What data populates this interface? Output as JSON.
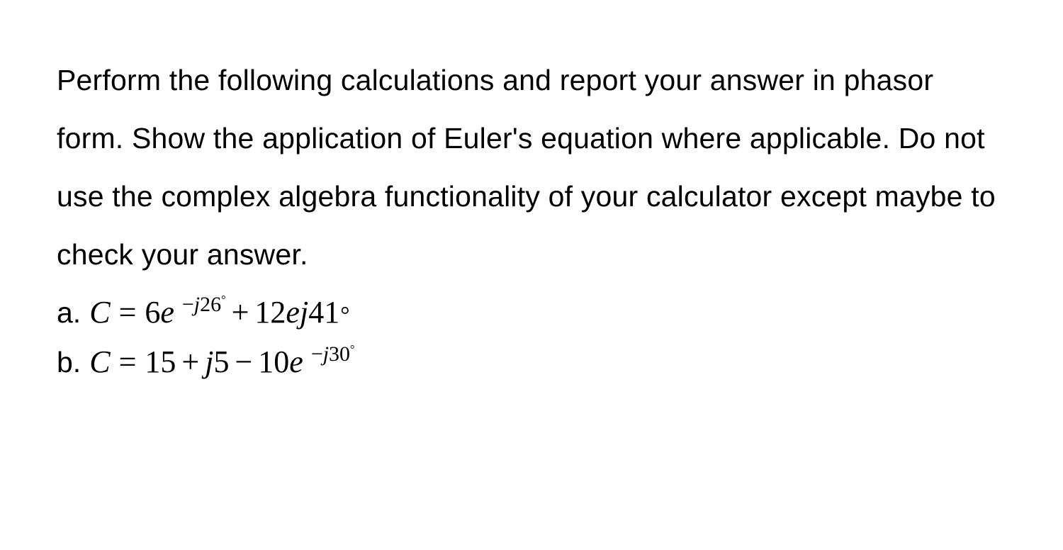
{
  "paragraph": "Perform the following calculations and report your answer in phasor form. Show the application of Euler's equation where applicable. Do not use the complex algebra functionality of your calculator except maybe to check your answer.",
  "items": {
    "a": {
      "label": "a.",
      "lhs": "C",
      "eq": "=",
      "term1_coef": "6",
      "term1_base": "e",
      "term1_exp_sign": "−",
      "term1_exp_j": "j",
      "term1_exp_val": "26",
      "op1": "+",
      "term2_coef": "12",
      "term2_e": "e",
      "term2_j": "j",
      "term2_val": "41"
    },
    "b": {
      "label": "b.",
      "lhs": "C",
      "eq": "=",
      "term1": "15",
      "op1": "+",
      "term2_j": "j",
      "term2_val": "5",
      "op2": "−",
      "term3_coef": "10",
      "term3_base": "e",
      "term3_exp_sign": "−",
      "term3_exp_j": "j",
      "term3_exp_val": "30"
    }
  }
}
